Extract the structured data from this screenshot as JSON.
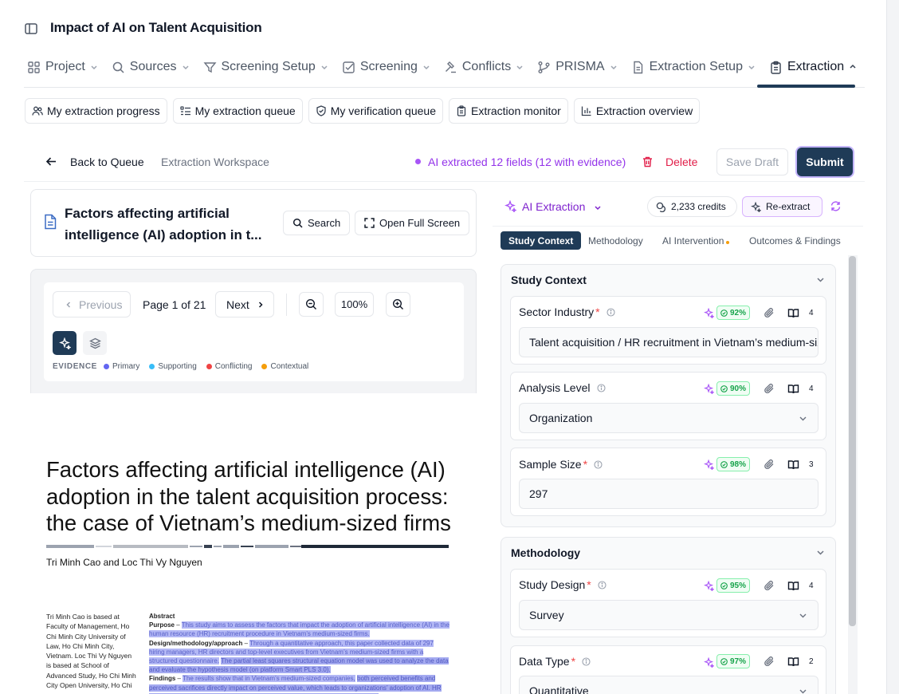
{
  "app": {
    "title": "Impact of AI on Talent Acquisition"
  },
  "nav": {
    "items": [
      {
        "label": "Project",
        "icon": "grid-icon"
      },
      {
        "label": "Sources",
        "icon": "search-icon"
      },
      {
        "label": "Screening Setup",
        "icon": "filter-icon"
      },
      {
        "label": "Screening",
        "icon": "checkbox-icon"
      },
      {
        "label": "Conflicts",
        "icon": "gavel-icon"
      },
      {
        "label": "PRISMA",
        "icon": "branch-icon"
      },
      {
        "label": "Extraction Setup",
        "icon": "document-icon"
      },
      {
        "label": "Extraction",
        "icon": "clipboard-icon"
      }
    ],
    "active": "Extraction"
  },
  "subtabs": [
    {
      "label": "My extraction progress",
      "icon": "users-icon"
    },
    {
      "label": "My extraction queue",
      "icon": "list-icon"
    },
    {
      "label": "My verification queue",
      "icon": "shield-check-icon"
    },
    {
      "label": "Extraction monitor",
      "icon": "clipboard-icon"
    },
    {
      "label": "Extraction overview",
      "icon": "bar-chart-icon"
    }
  ],
  "workspace": {
    "back_label": "Back to Queue",
    "title": "Extraction Workspace",
    "ai_status": "AI extracted 12 fields (12 with evidence)",
    "delete_label": "Delete",
    "save_draft_label": "Save Draft",
    "submit_label": "Submit"
  },
  "document": {
    "title": "Factors affecting artificial intelligence (AI) adoption in t...",
    "search_label": "Search",
    "fullscreen_label": "Open Full Screen",
    "prev_label": "Previous",
    "page_label": "Page 1 of 21",
    "next_label": "Next",
    "zoom_level": "100%",
    "legend": {
      "title": "EVIDENCE",
      "items": [
        {
          "label": "Primary",
          "color": "#6366f1"
        },
        {
          "label": "Supporting",
          "color": "#38bdf8"
        },
        {
          "label": "Conflicting",
          "color": "#ef4444"
        },
        {
          "label": "Contextual",
          "color": "#f59e0b"
        }
      ]
    }
  },
  "paper": {
    "title": "Factors affecting artificial intelligence (AI) adoption in the talent acquisition process: the case of Vietnam’s medium-sized firms",
    "author1": "Tri Minh Cao",
    "author_and": "and",
    "author2": "Loc Thi Vy Nguyen",
    "affiliation": "Tri Minh Cao is based at Faculty of Management, Ho Chi Minh City University of Law, Ho Chi Minh City, Vietnam. Loc Thi Vy Nguyen is based at School of Advanced Study, Ho Chi Minh City Open University, Ho Chi",
    "abstract_heading": "Abstract",
    "purpose_heading": "Purpose",
    "purpose_text": "This study aims to assess the factors that impact the adoption of artificial intelligence (AI) in the human resource (HR) recruitment procedure in Vietnam’s medium-sized firms.",
    "design_heading": "Design/methodology/approach",
    "design_text_1": "Through a quantitative approach, this paper collected data of 297 hiring managers, HR directors and top-level executives from Vietnam’s medium-sized firms with a structured questionnaire.",
    "design_text_2": "The partial least squares structural equation model was used to analyze the data and evaluate the hypothesis model (on platform Smart PLS 3.0).",
    "findings_heading": "Findings",
    "findings_text_1": "The results show that in Vietnam’s medium-sized companies,",
    "findings_text_2": "both perceived benefits and perceived sacrifices directly impact on perceived value, which leads to organizations’ adoption of AI. HR readiness also has a moderating effect between perceived value and AI adoption."
  },
  "ai_panel": {
    "label": "AI Extraction",
    "credits": "2,233 credits",
    "reextract_label": "Re-extract",
    "tabs": [
      "Study Context",
      "Methodology",
      "AI Intervention",
      "Outcomes & Findings"
    ],
    "active_tab": "Study Context"
  },
  "sections": [
    {
      "title": "Study Context",
      "fields": [
        {
          "label": "Sector Industry",
          "confidence": "92%",
          "evidence_count": "4",
          "value": "Talent acquisition / HR recruitment in Vietnam’s medium-sized firms",
          "type": "text"
        },
        {
          "label": "Analysis Level",
          "confidence": "90%",
          "evidence_count": "4",
          "value": "Organization",
          "type": "select"
        },
        {
          "label": "Sample Size",
          "confidence": "98%",
          "evidence_count": "3",
          "value": "297",
          "type": "text"
        }
      ]
    },
    {
      "title": "Methodology",
      "fields": [
        {
          "label": "Study Design",
          "confidence": "95%",
          "evidence_count": "4",
          "value": "Survey",
          "type": "select"
        },
        {
          "label": "Data Type",
          "confidence": "97%",
          "evidence_count": "2",
          "value": "Quantitative",
          "type": "select"
        }
      ]
    }
  ]
}
